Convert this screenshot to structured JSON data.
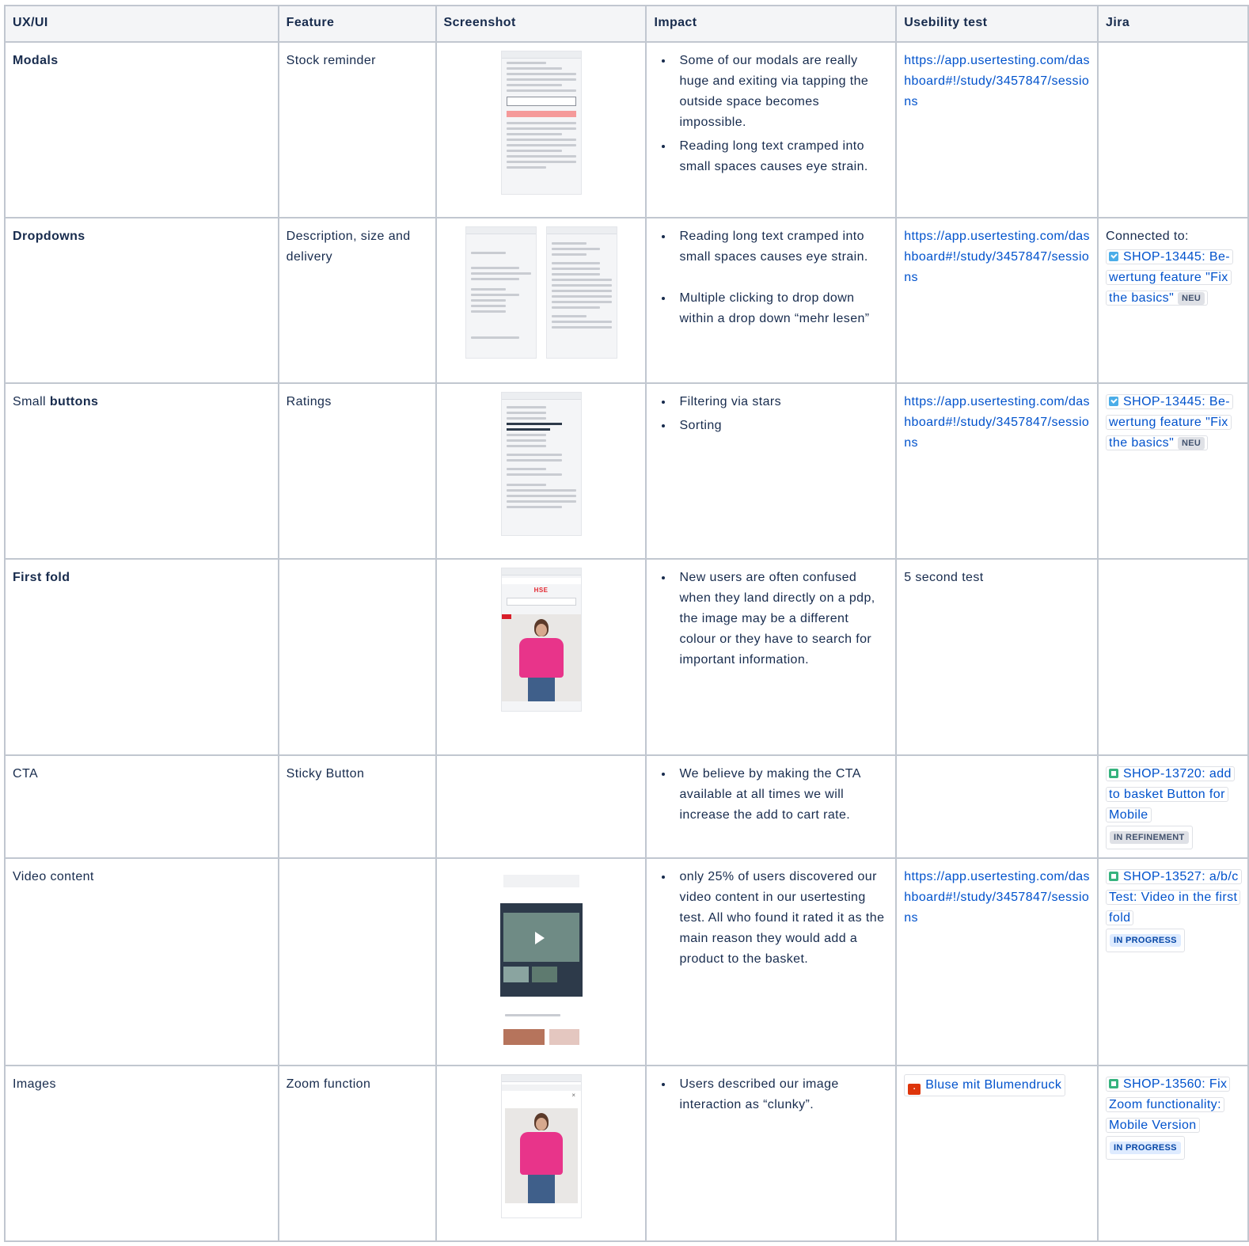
{
  "headers": [
    "UX/UI",
    "Feature",
    "Screenshot",
    "Impact",
    "Usebility test",
    "Jira"
  ],
  "rows": [
    {
      "uxui_plain": "",
      "uxui_bold": "Modals",
      "feature": "Stock reminder",
      "impact": [
        "Some of our modals are really huge and exiting via tapping the outside space becomes impossible.",
        "Reading long text cramped into small spaces causes eye strain."
      ],
      "test_link": "https://app.usertesting.com/dashboard#!/study/3457847/sessions"
    },
    {
      "uxui_plain": "",
      "uxui_bold": "Dropdowns",
      "feature": "Description, size and delivery",
      "impact": [
        "Reading long text cramped into small spaces causes eye strain.",
        "Multiple clicking to drop down within a drop down “mehr lesen”"
      ],
      "test_link": "https://app.usertesting.com/dashboard#!/study/3457847/sessions",
      "jira_prefix": "Connected to:",
      "jira": {
        "key": "SHOP-13445: Be-wertung feature \"Fix the basics\"",
        "status": "NEU"
      }
    },
    {
      "uxui_plain": "Small ",
      "uxui_bold": "buttons",
      "feature": "Ratings",
      "impact": [
        "Filtering via stars",
        "Sorting"
      ],
      "test_link": "https://app.usertesting.com/dashboard#!/study/3457847/sessions",
      "jira": {
        "key": "SHOP-13445: Be-wertung feature \"Fix the basics\"",
        "status": "NEU"
      }
    },
    {
      "uxui_plain": "",
      "uxui_bold": "First fold",
      "feature": "",
      "impact": [
        "New users are often confused when they land directly on a pdp, the image may be a different colour or they have to search for important information."
      ],
      "test_text": "5 second test"
    },
    {
      "uxui_plain": "CTA",
      "uxui_bold": "",
      "feature": "Sticky Button",
      "impact": [
        "We believe by making the CTA available at all times we will increase the add to cart rate."
      ],
      "jira": {
        "key": "SHOP-13720: add to basket Button for Mobile",
        "status": "IN REFINEMENT"
      }
    },
    {
      "uxui_plain": "Video content",
      "uxui_bold": "",
      "feature": "",
      "impact": [
        "only 25% of users discovered our video content in our usertesting test. All who found it rated it as the main reason they would add a product to the basket."
      ],
      "test_link": "https://app.usertesting.com/dashboard#!/study/3457847/sessions",
      "jira": {
        "key": "SHOP-13527: a/b/c Test: Video in the first fold",
        "status": "IN PROGRESS"
      }
    },
    {
      "uxui_plain": "Images",
      "uxui_bold": "",
      "feature": "Zoom function",
      "impact": [
        "Users described our image interaction as “clunky”."
      ],
      "test_doc": "Bluse mit Blumendruck",
      "jira": {
        "key": "SHOP-13560: Fix Zoom functionality: Mobile Version",
        "status": "IN PROGRESS"
      }
    }
  ],
  "icons": {
    "task": "checkbox-task-icon",
    "story": "story-icon",
    "doc": "document-icon"
  },
  "colors": {
    "link": "#0052cc",
    "border": "#c1c7d0",
    "header_bg": "#f4f5f7",
    "shirt": "#e8348a"
  }
}
